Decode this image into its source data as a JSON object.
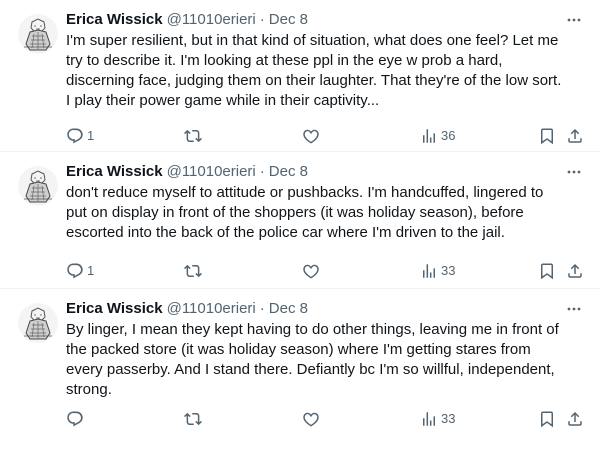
{
  "tweets": [
    {
      "author": "Erica Wissick",
      "handle": "@11010erieri",
      "separator": "·",
      "date": "Dec 8",
      "lines": [
        "I'm super resilient, but in that kind of situation, what does one feel? Let me",
        "try to describe it. I'm looking at these ppl in the eye w prob a hard,",
        "discerning face, judging them on their laughter. That they're of the low sort.",
        "I play their power game while in their captivity..."
      ],
      "replies": "1",
      "retweets": "",
      "likes": "",
      "views": "36"
    },
    {
      "author": "Erica Wissick",
      "handle": "@11010erieri",
      "separator": "·",
      "date": "Dec 8",
      "lines": [
        "don't reduce myself to attitude or pushbacks. I'm handcuffed, lingered to",
        "put on display in front of the shoppers (it was holiday season), before",
        "escorted into the back of the police car where I'm driven to the jail."
      ],
      "replies": "1",
      "retweets": "",
      "likes": "",
      "views": "33"
    },
    {
      "author": "Erica Wissick",
      "handle": "@11010erieri",
      "separator": "·",
      "date": "Dec 8",
      "lines": [
        "By linger, I mean they kept having to do other things, leaving me in front of",
        "the packed store (it was holiday season) where I'm getting stares from",
        "every passerby. And I stand there. Defiantly bc I'm so willful, independent,",
        "strong."
      ],
      "replies": "",
      "retweets": "",
      "likes": "",
      "views": "33"
    }
  ],
  "icons": {
    "more": "more-dots-icon",
    "reply": "reply-bubble-icon",
    "retweet": "retweet-icon",
    "like": "heart-icon",
    "views": "views-chart-icon",
    "bookmark": "bookmark-icon",
    "share": "share-icon"
  },
  "colors": {
    "text": "#0f1419",
    "secondary": "#536471",
    "divider": "#eff3f4"
  }
}
